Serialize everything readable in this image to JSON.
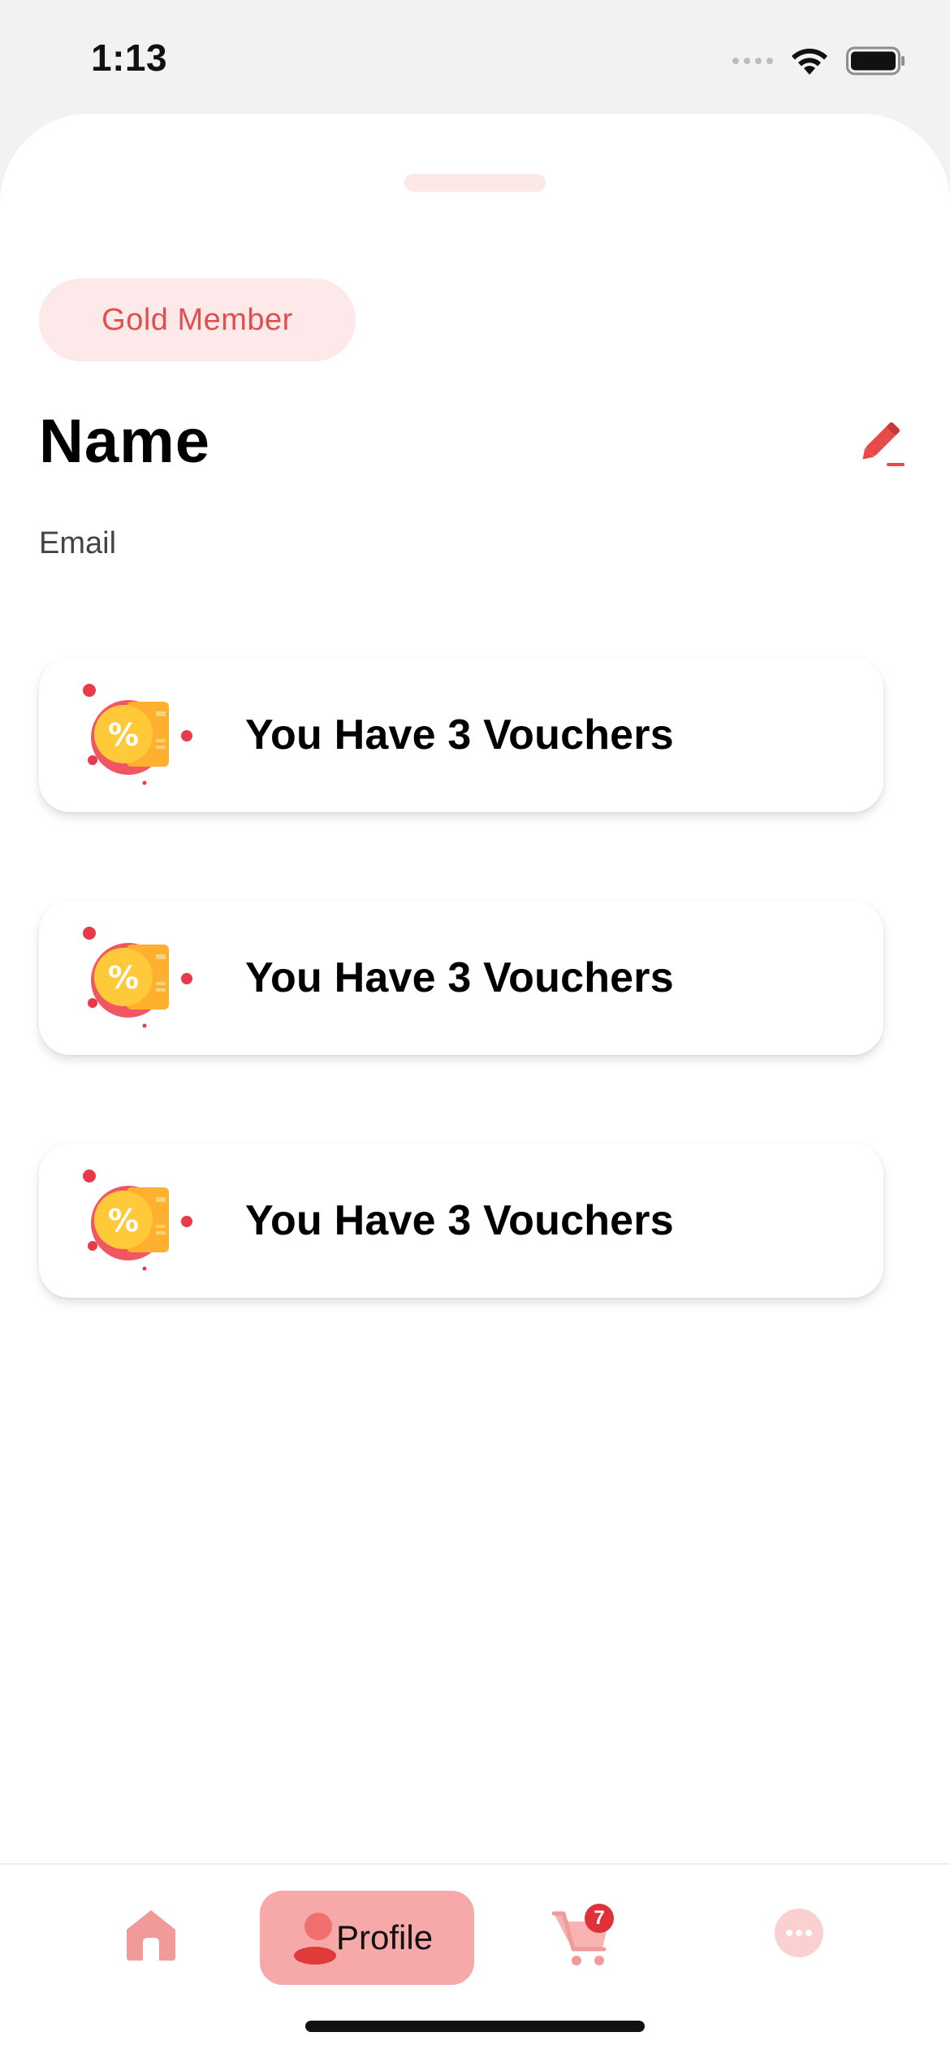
{
  "status_bar": {
    "time": "1:13"
  },
  "profile": {
    "membership_badge": "Gold Member",
    "name": "Name",
    "email": "Email"
  },
  "vouchers": [
    {
      "label": "You Have 3 Vouchers"
    },
    {
      "label": "You Have 3 Vouchers"
    },
    {
      "label": "You Have 3 Vouchers"
    }
  ],
  "nav": {
    "home_icon": "home-icon",
    "profile_label": "Profile",
    "cart_icon": "cart-icon",
    "cart_count": "7",
    "chat_icon": "chat-icon",
    "active": "profile"
  },
  "colors": {
    "accent": "#e0504f",
    "badge_bg": "#fde9e9",
    "nav_active_bg": "#f7a9a9",
    "cart_badge": "#e0303a"
  }
}
